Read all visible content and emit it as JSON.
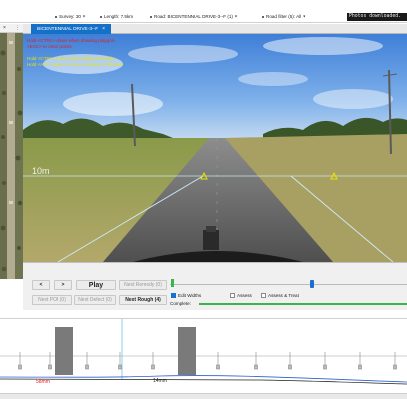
{
  "topbar": {
    "survey": "Survey: 30",
    "length": "Length: 7.5km",
    "road": "Road: BICENTENNIAL DRIVE-3--F (1)",
    "road_filter": "Road filter (5): All",
    "status_message": "Photos downloaded."
  },
  "left_header": {
    "close_glyph": "×",
    "menu_glyph": "⋮"
  },
  "tab": {
    "label": "BICENTENNIAL DRIVE-3--F",
    "close_glyph": "×"
  },
  "video_overlay": {
    "red_lines": [
      "Hold <CTRL> down when drawing polygon.",
      "<ESC> to clear points"
    ],
    "yellow_lines": [
      "Hold <CTRL> down when adding rectangle.",
      "Hold <ALT> down to clear rectangle on this site"
    ],
    "distance_label": "10m"
  },
  "controls": {
    "prev_label": "<",
    "next_label": ">",
    "play_label": "Play",
    "next_remedy_label": "Next Remedy (0)",
    "next_poi_label": "Next POI (0)",
    "next_defect_label": "Next Defect (0)",
    "next_rough_label": "Next Rough (4)",
    "edit_widths_label": "Edit Widths",
    "assess_label": "Assess",
    "assess_treat_label": "Assess & Treat",
    "complete_label": "Complete:",
    "slider_position": 0.6,
    "edit_widths_checked": true,
    "assess_checked": false,
    "assess_treat_checked": false
  },
  "profile": {
    "label_left": "58mm",
    "label_right": "14mm"
  },
  "colors": {
    "accent": "#1570c8",
    "complete": "#3bb54a",
    "overlay_red": "#e02020",
    "overlay_yellow": "#e6e600",
    "label_red": "#e02020"
  }
}
